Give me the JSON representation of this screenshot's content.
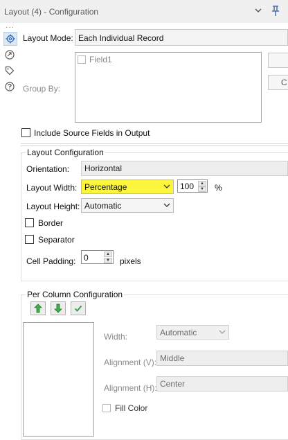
{
  "window": {
    "title": "Layout (4) - Configuration"
  },
  "layout_mode": {
    "label": "Layout Mode:",
    "value": "Each Individual Record"
  },
  "group_by": {
    "label": "Group By:",
    "fields": [
      "Field1"
    ]
  },
  "include_source": {
    "label": "Include Source Fields in Output",
    "checked": false
  },
  "layout_config": {
    "title": "Layout Configuration",
    "orientation": {
      "label": "Orientation:",
      "value": "Horizontal"
    },
    "layout_width": {
      "label": "Layout Width:",
      "value": "Percentage",
      "amount": "100",
      "unit": "%"
    },
    "layout_height": {
      "label": "Layout Height:",
      "value": "Automatic"
    },
    "border": {
      "label": "Border",
      "checked": false
    },
    "separator": {
      "label": "Separator",
      "checked": false
    },
    "cell_padding": {
      "label": "Cell Padding:",
      "value": "0",
      "unit": "pixels"
    }
  },
  "per_column": {
    "title": "Per Column Configuration",
    "width": {
      "label": "Width:",
      "value": "Automatic"
    },
    "alignment_v": {
      "label": "Alignment (V):",
      "value": "Middle"
    },
    "alignment_h": {
      "label": "Alignment (H):",
      "value": "Center"
    },
    "fill_color": {
      "label": "Fill Color",
      "checked": false
    }
  },
  "side_buttons": {
    "b2": "C"
  },
  "colors": {
    "highlight": "#fbf63c",
    "accent": "#2a6bb8",
    "move_green": "#2f9a3a"
  }
}
